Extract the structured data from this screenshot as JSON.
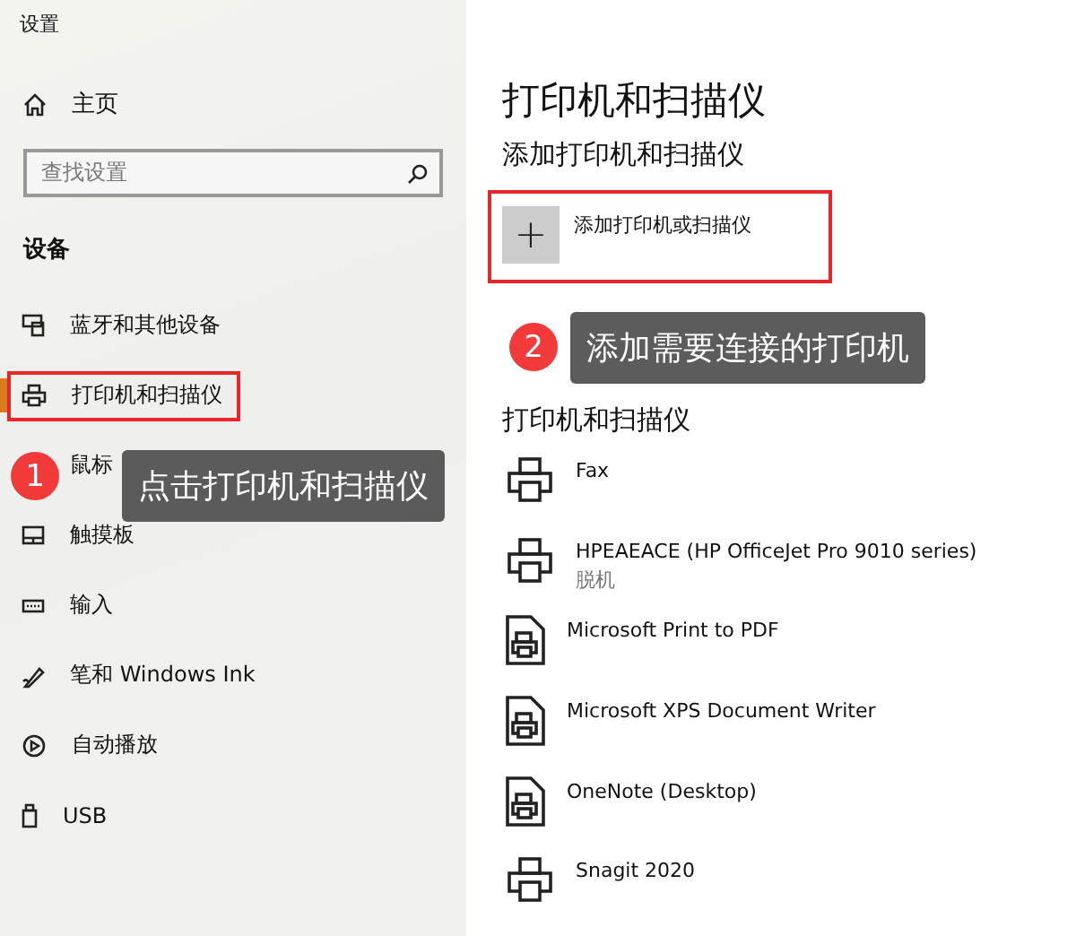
{
  "window": {
    "title": "设置"
  },
  "sidebar": {
    "home": "主页",
    "search": {
      "placeholder": "查找设置"
    },
    "section": "设备",
    "items": [
      {
        "label": "蓝牙和其他设备",
        "selected": false,
        "highlighted": false
      },
      {
        "label": "打印机和扫描仪",
        "selected": true,
        "highlighted": true
      },
      {
        "label": "鼠标",
        "selected": false,
        "highlighted": false
      },
      {
        "label": "触摸板",
        "selected": false,
        "highlighted": false
      },
      {
        "label": "输入",
        "selected": false,
        "highlighted": false
      },
      {
        "label": "笔和 Windows Ink",
        "selected": false,
        "highlighted": false
      },
      {
        "label": "自动播放",
        "selected": false,
        "highlighted": false
      },
      {
        "label": "USB",
        "selected": false,
        "highlighted": false
      }
    ]
  },
  "main": {
    "title": "打印机和扫描仪",
    "subtitle": "添加打印机和扫描仪",
    "add_button": {
      "plus": "+",
      "label": "添加打印机或扫描仪",
      "highlighted": true
    },
    "list_heading": "打印机和扫描仪",
    "printers": [
      {
        "kind": "printer",
        "name": "Fax"
      },
      {
        "kind": "printer",
        "name": "HPEAEACE (HP OfficeJet Pro 9010 series)",
        "status": "脱机"
      },
      {
        "kind": "document",
        "name": "Microsoft Print to PDF"
      },
      {
        "kind": "document",
        "name": "Microsoft XPS Document Writer"
      },
      {
        "kind": "document",
        "name": "OneNote (Desktop)"
      },
      {
        "kind": "printer",
        "name": "Snagit 2020"
      }
    ]
  },
  "annotations": [
    {
      "number": "1",
      "text": "点击打印机和扫描仪"
    },
    {
      "number": "2",
      "text": "添加需要连接的打印机"
    }
  ]
}
